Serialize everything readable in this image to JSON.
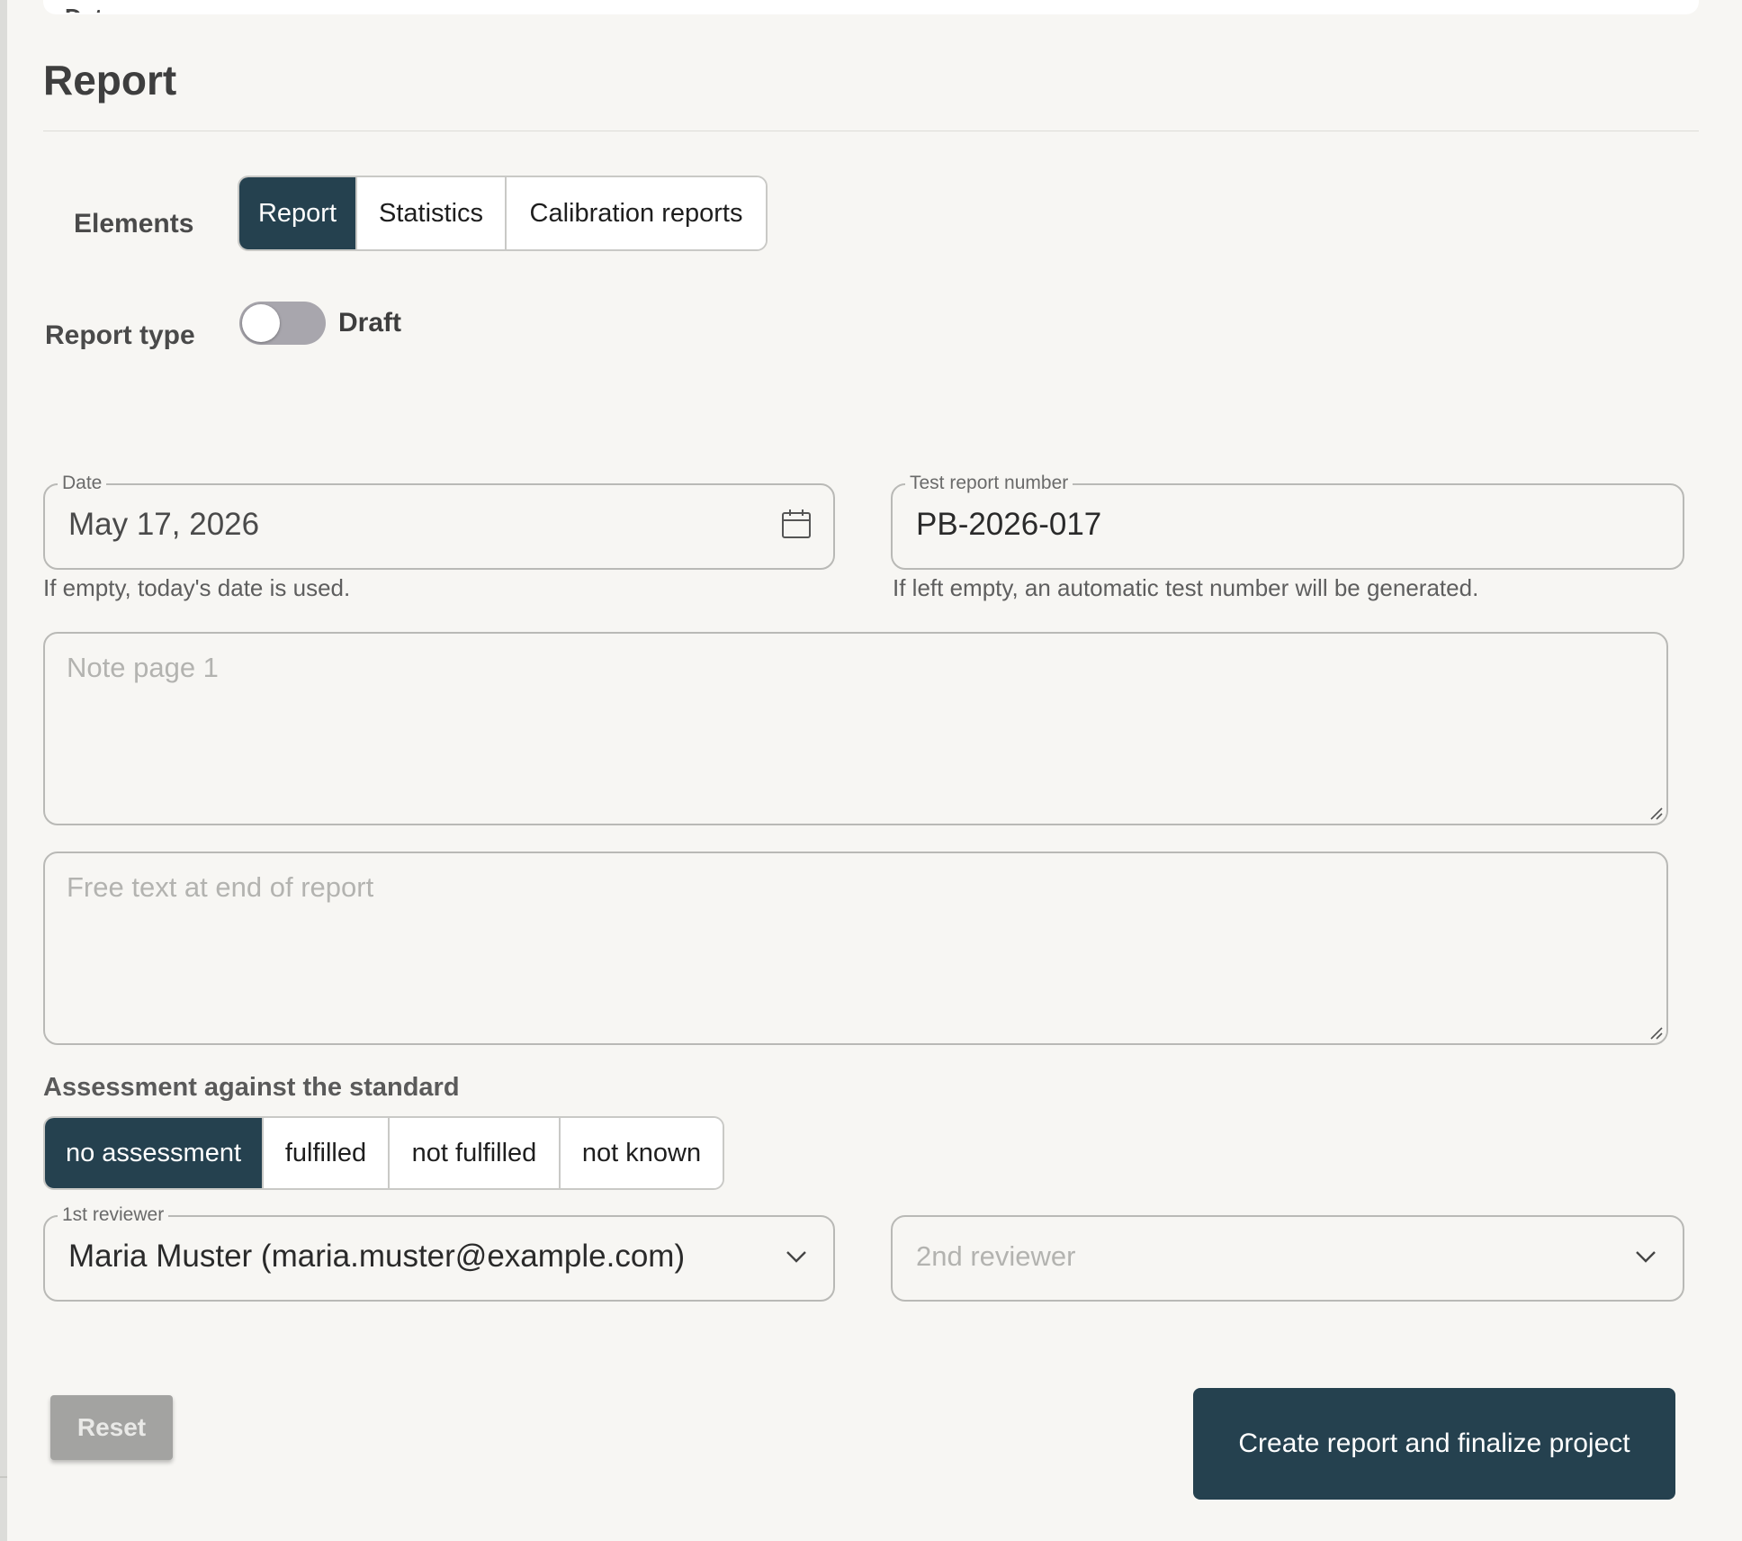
{
  "top_card": {
    "partial_text": "Data"
  },
  "page": {
    "title": "Report"
  },
  "elements": {
    "label": "Elements",
    "options": [
      "Report",
      "Statistics",
      "Calibration reports"
    ],
    "selected": "Report"
  },
  "report_type": {
    "label": "Report type",
    "toggle_on": false,
    "toggle_label": "Draft"
  },
  "date_field": {
    "legend": "Date",
    "value": "May 17, 2026",
    "helper": "If empty, today's date is used."
  },
  "test_report_number": {
    "legend": "Test report number",
    "value": "PB-2026-017",
    "helper": "If left empty, an automatic test number will be generated."
  },
  "note_page_1": {
    "placeholder": "Note page 1",
    "value": ""
  },
  "free_text_end": {
    "placeholder": "Free text at end of report",
    "value": ""
  },
  "assessment": {
    "label": "Assessment against the standard",
    "options": [
      "no assessment",
      "fulfilled",
      "not fulfilled",
      "not known"
    ],
    "selected": "no assessment"
  },
  "reviewer_1": {
    "legend": "1st reviewer",
    "value": "Maria Muster (maria.muster@example.com)"
  },
  "reviewer_2": {
    "placeholder": "2nd reviewer",
    "value": ""
  },
  "actions": {
    "reset_label": "Reset",
    "submit_label": "Create report and finalize project"
  },
  "colors": {
    "accent": "#25414f",
    "background": "#f7f6f3",
    "reset_bg": "#a3a3a1",
    "toggle_off": "#a8a6ad"
  },
  "icons": {
    "date": "calendar-icon",
    "select": "chevron-down-icon",
    "textarea": "resize-handle-icon"
  }
}
